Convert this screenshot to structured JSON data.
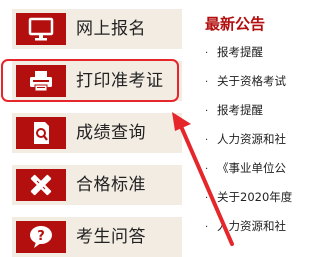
{
  "sidebar": {
    "items": [
      {
        "label": "网上报名",
        "icon": "monitor-icon"
      },
      {
        "label": "打印准考证",
        "icon": "printer-icon"
      },
      {
        "label": "成绩查询",
        "icon": "document-search-icon"
      },
      {
        "label": "合格标准",
        "icon": "pencil-ruler-icon"
      },
      {
        "label": "考生问答",
        "icon": "question-bubble-icon"
      }
    ]
  },
  "news": {
    "title": "最新公告",
    "bullet": "·",
    "items": [
      "报考提醒",
      "关于资格考试",
      "报考提醒",
      "人力资源和社",
      "《事业单位公",
      "关于2020年度",
      "人力资源和社"
    ]
  },
  "colors": {
    "brand_red": "#b40f0f",
    "menu_background": "#f3ece3",
    "highlight_annotation": "#e5262b"
  }
}
